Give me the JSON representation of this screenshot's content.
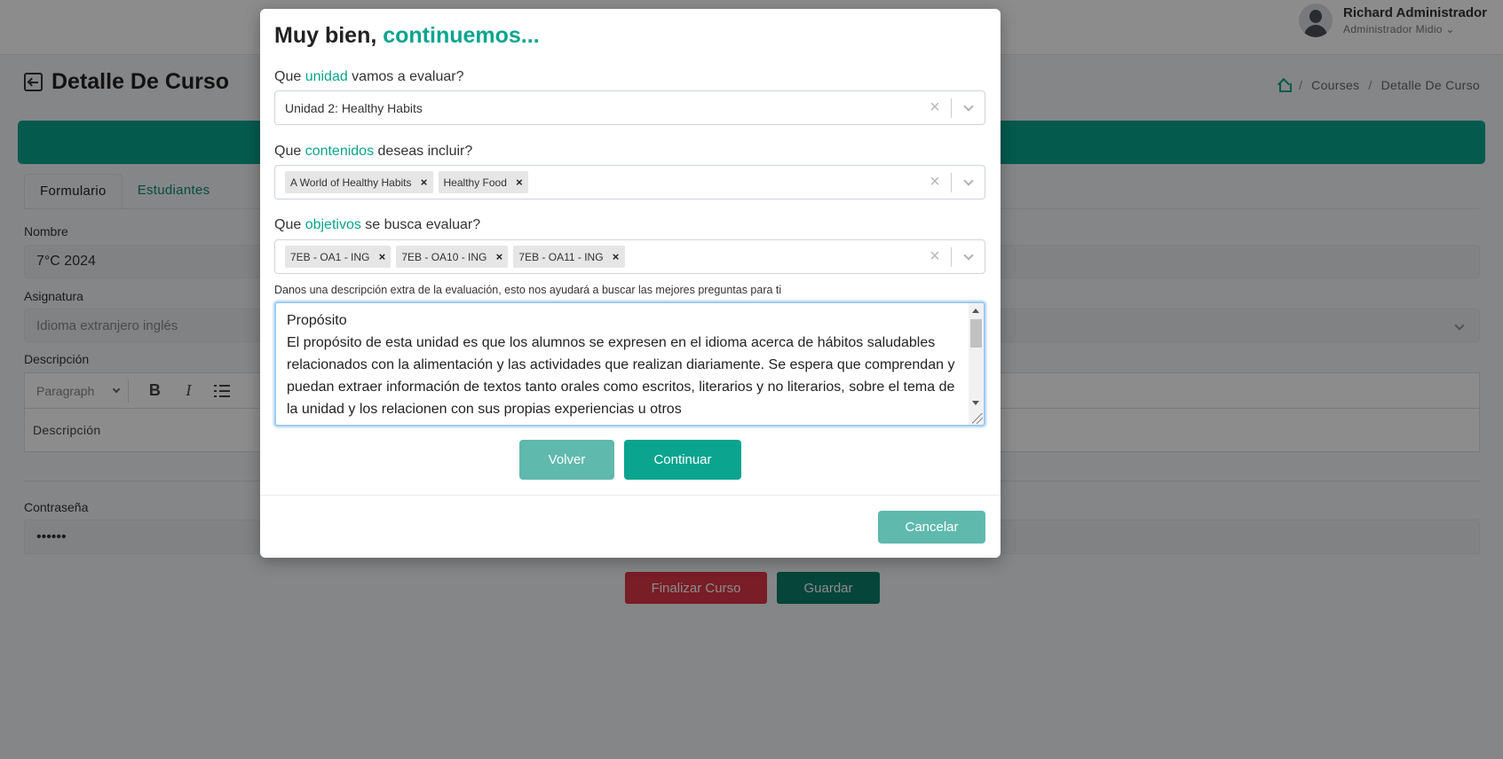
{
  "header": {
    "user_name": "Richard Administrador",
    "user_role": "Administrador Midio ⌄"
  },
  "page": {
    "title": "Detalle De Curso",
    "breadcrumb": [
      "Courses",
      "Detalle De Curso"
    ],
    "tabs": [
      {
        "label": "Formulario",
        "active": true
      },
      {
        "label": "Estudiantes",
        "active": false
      }
    ]
  },
  "form": {
    "name_label": "Nombre",
    "name_value": "7°C 2024",
    "subject_label": "Asignatura",
    "subject_value": "Idioma extranjero inglés",
    "description_label": "Descripción",
    "editor_paragraph": "Paragraph",
    "editor_placeholder": "Descripción",
    "password_label": "Contraseña",
    "password_value": "••••••",
    "finalize_label": "Finalizar Curso",
    "save_label": "Guardar"
  },
  "modal": {
    "title_prefix": "Muy bien, ",
    "title_accent": "continuemos...",
    "q1": {
      "pre": "Que ",
      "accent": "unidad",
      "post": " vamos a evaluar?"
    },
    "unit_value": "Unidad 2: Healthy Habits",
    "q2": {
      "pre": "Que ",
      "accent": "contenidos",
      "post": " deseas incluir?"
    },
    "contents": [
      "A World of Healthy Habits",
      "Healthy Food"
    ],
    "q3": {
      "pre": "Que ",
      "accent": "objetivos",
      "post": " se busca evaluar?"
    },
    "objectives": [
      "7EB - OA1 - ING",
      "7EB - OA10 - ING",
      "7EB - OA11 - ING"
    ],
    "extra_label": "Danos una descripción extra de la evaluación, esto nos ayudará a buscar las mejores preguntas para ti",
    "description_text": "Propósito\nEl propósito de esta unidad es que los alumnos se expresen en el idioma acerca de hábitos saludables relacionados con la alimentación y las actividades que realizan diariamente. Se espera que comprendan y puedan extraer información de textos tanto orales como escritos, literarios y no literarios, sobre el tema de la unidad y los relacionen con sus propias experiencias u otros",
    "back_label": "Volver",
    "continue_label": "Continuar",
    "cancel_label": "Cancelar"
  },
  "colors": {
    "accent": "#0aa48f",
    "accent_light": "#5fb9ad",
    "danger": "#dc3545"
  }
}
